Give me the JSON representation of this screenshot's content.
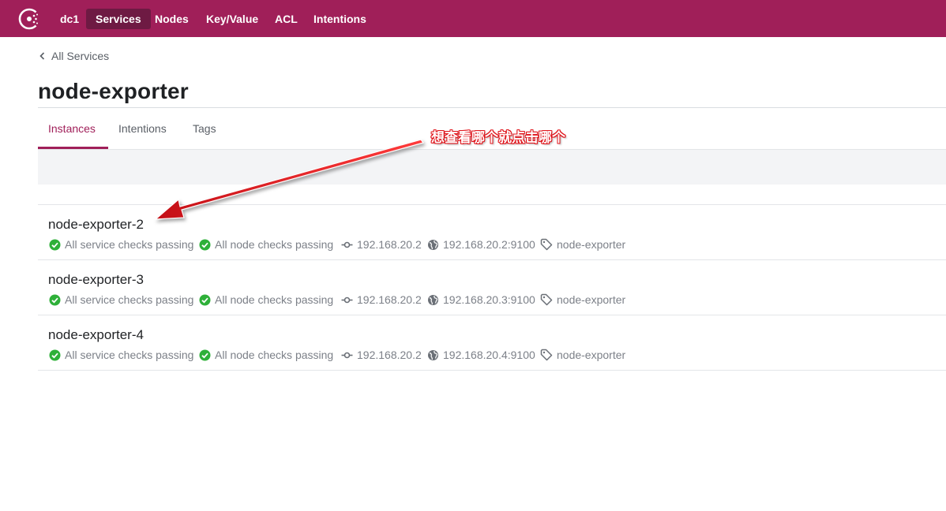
{
  "topnav": {
    "logo_icon": "consul-logo-icon",
    "datacenter": "dc1",
    "items": [
      "Services",
      "Nodes",
      "Key/Value",
      "ACL",
      "Intentions"
    ],
    "active": "Services",
    "background": "#a01f59"
  },
  "breadcrumb": {
    "label": "All Services",
    "icon": "chevron-left-icon"
  },
  "page": {
    "title": "node-exporter"
  },
  "tabs": {
    "items": [
      "Instances",
      "Intentions",
      "Tags"
    ],
    "active": "Instances",
    "accent": "#a01f59"
  },
  "instances": [
    {
      "name": "node-exporter-2",
      "service_checks": "All service checks passing",
      "node_checks": "All node checks passing",
      "node_address": "192.168.20.2",
      "service_address": "192.168.20.2:9100",
      "tag": "node-exporter"
    },
    {
      "name": "node-exporter-3",
      "service_checks": "All service checks passing",
      "node_checks": "All node checks passing",
      "node_address": "192.168.20.2",
      "service_address": "192.168.20.3:9100",
      "tag": "node-exporter"
    },
    {
      "name": "node-exporter-4",
      "service_checks": "All service checks passing",
      "node_checks": "All node checks passing",
      "node_address": "192.168.20.2",
      "service_address": "192.168.20.4:9100",
      "tag": "node-exporter"
    }
  ],
  "annotation": {
    "text": "想查看哪个就点击哪个",
    "color": "#e0141b"
  },
  "colors": {
    "check_passing": "#2eb039",
    "muted_text": "#7c8088"
  }
}
